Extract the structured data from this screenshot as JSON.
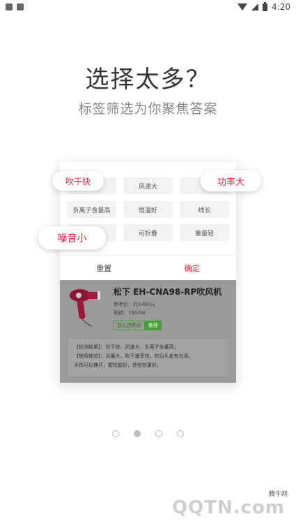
{
  "status_bar": {
    "time": "4:20"
  },
  "hero": {
    "title": "选择太多？",
    "subtitle": "标签筛选为你聚焦答案"
  },
  "tags": [
    {
      "label": ""
    },
    {
      "label": "风速大"
    },
    {
      "label": ""
    },
    {
      "label": "负离子含量高"
    },
    {
      "label": "恒温好"
    },
    {
      "label": "线长"
    },
    {
      "label": ""
    },
    {
      "label": "可折叠"
    },
    {
      "label": "重量轻"
    }
  ],
  "card_actions": {
    "reset": "重置",
    "confirm": "确定"
  },
  "product": {
    "name": "松下 EH-CNA98-RP吹风机",
    "ref_price": "参考价：约1480元",
    "spec": "规格：1600W",
    "badge_outline": "放心选购点",
    "badge_filled": "推荐",
    "result_line1": "【检测结果】：吹干快、风速大、负离子含量高；",
    "result_line2": "【使用体验】：风量大、吹干速率快，吹后头发有光泽，",
    "result_line3": "手指可以伸开，握松握好，造型效果好。"
  },
  "floating_tags": {
    "left_top": "吹干快",
    "right_top": "功率大",
    "left_mid": "噪音小"
  },
  "pager": {
    "count": 4,
    "active": 1
  },
  "watermark": {
    "small": "腾牛网",
    "big": "QQTN.com"
  },
  "colors": {
    "accent_red": "#e0213c",
    "badge_green": "#4a9e3a"
  }
}
